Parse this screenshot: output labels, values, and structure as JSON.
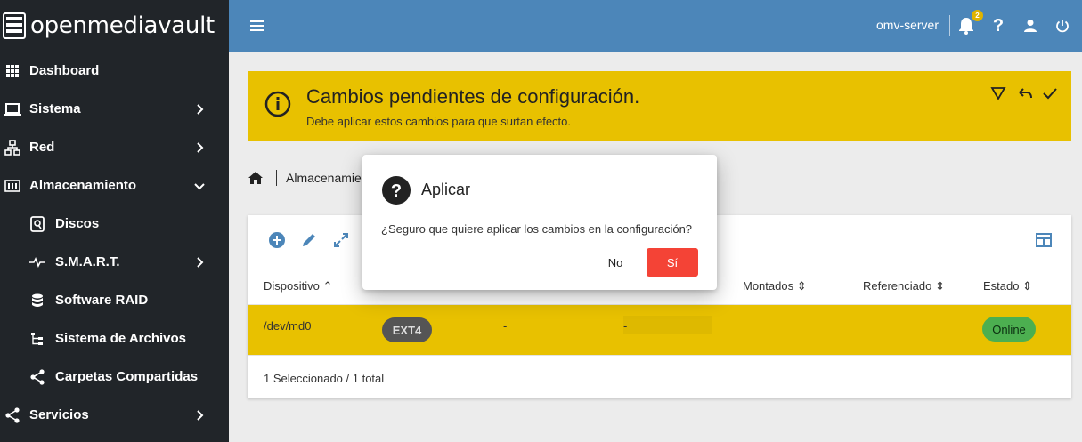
{
  "app": {
    "name": "openmediavault"
  },
  "sidebar": {
    "items": [
      {
        "label": "Dashboard",
        "icon": "grid-icon",
        "expandable": false
      },
      {
        "label": "Sistema",
        "icon": "laptop-icon",
        "expandable": true,
        "expanded": false
      },
      {
        "label": "Red",
        "icon": "network-icon",
        "expandable": true,
        "expanded": false
      },
      {
        "label": "Almacenamiento",
        "icon": "storage-icon",
        "expandable": true,
        "expanded": true
      },
      {
        "label": "Discos",
        "icon": "harddisk-icon",
        "sub": true
      },
      {
        "label": "S.M.A.R.T.",
        "icon": "heartbeat-icon",
        "sub": true,
        "expandable": true
      },
      {
        "label": "Software RAID",
        "icon": "database-icon",
        "sub": true
      },
      {
        "label": "Sistema de Archivos",
        "icon": "file-tree-icon",
        "sub": true
      },
      {
        "label": "Carpetas Compartidas",
        "icon": "share-icon",
        "sub": true
      },
      {
        "label": "Servicios",
        "icon": "share-icon",
        "expandable": true,
        "expanded": false
      }
    ]
  },
  "topbar": {
    "server_name": "omv-server",
    "notification_count": "2"
  },
  "banner": {
    "title": "Cambios pendientes de configuración.",
    "subtitle": "Debe aplicar estos cambios para que surtan efecto."
  },
  "breadcrumb": {
    "current": "Almacenamiento"
  },
  "table": {
    "columns": [
      "Dispositivo",
      "Montados",
      "Referenciado",
      "Estado"
    ],
    "rows": [
      {
        "device": "/dev/md0",
        "type": "EXT4",
        "col3": "-",
        "col4": "-",
        "status": "Online"
      }
    ],
    "footer": "1 Seleccionado / 1 total"
  },
  "dialog": {
    "title": "Aplicar",
    "message": "¿Seguro que quiere aplicar los cambios en la configuración?",
    "no_label": "No",
    "yes_label": "Sí"
  },
  "colors": {
    "sidebar_bg": "#212529",
    "topbar_bg": "#4c86b9",
    "warning": "#e8c100",
    "danger": "#f44336",
    "success": "#4caf50"
  }
}
